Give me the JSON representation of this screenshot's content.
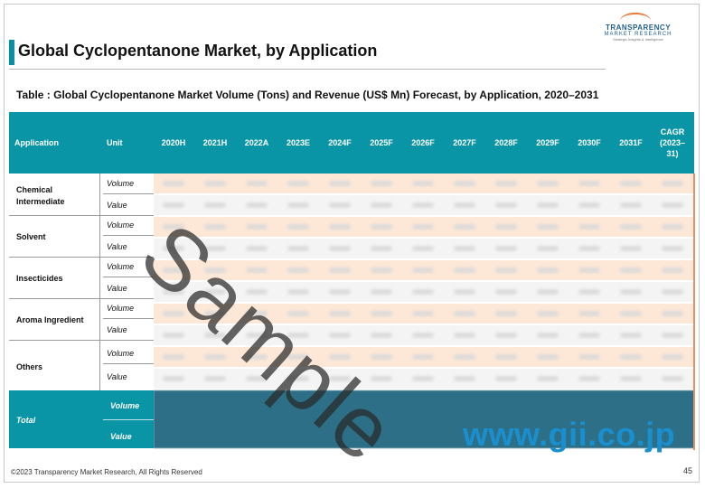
{
  "logo": {
    "name": "TRANSPARENCY",
    "sub": "MARKET RESEARCH",
    "tag": "Strategic Insights & Intelligence"
  },
  "heading": "Global Cyclopentanone Market, by Application",
  "caption": "Table : Global Cyclopentanone Market  Volume (Tons) and Revenue (US$ Mn) Forecast, by Application, 2020–2031",
  "table": {
    "columns": [
      "Application",
      "Unit",
      "2020H",
      "2021H",
      "2022A",
      "2023E",
      "2024F",
      "2025F",
      "2026F",
      "2027F",
      "2028F",
      "2029F",
      "2030F",
      "2031F",
      "CAGR (2023–31)"
    ],
    "rows": [
      {
        "application": "Chemical Intermediate",
        "units": [
          "Volume",
          "Value"
        ]
      },
      {
        "application": "Solvent",
        "units": [
          "Volume",
          "Value"
        ]
      },
      {
        "application": "Insecticides",
        "units": [
          "Volume",
          "Value"
        ]
      },
      {
        "application": "Aroma Ingredient",
        "units": [
          "Volume",
          "Value"
        ]
      },
      {
        "application": "Others",
        "units": [
          "Volume",
          "Value"
        ]
      }
    ],
    "total": {
      "application": "Total",
      "units": [
        "Volume",
        "Value"
      ]
    }
  },
  "watermark": "Sample",
  "site_watermark": "www.gii.co.jp",
  "footer": "©2023 Transparency Market Research, All Rights Reserved",
  "page_number": "45",
  "colors": {
    "header": "#0a95a6",
    "row_odd": "#fde8d7",
    "row_even": "#f4f4f4",
    "accent": "#e8793a"
  }
}
